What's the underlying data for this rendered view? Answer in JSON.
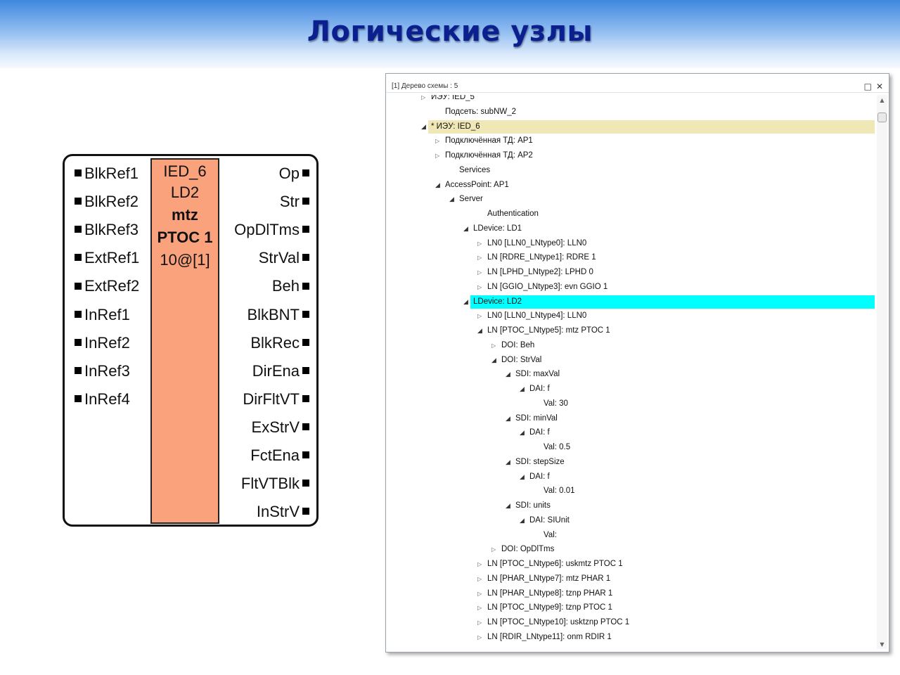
{
  "header": {
    "title": "Логические узлы"
  },
  "function_block": {
    "core": [
      "IED_6",
      "LD2",
      "mtz",
      "PTOC 1",
      "10@[1]"
    ],
    "inputs": [
      "BlkRef1",
      "BlkRef2",
      "BlkRef3",
      "ExtRef1",
      "ExtRef2",
      "InRef1",
      "InRef2",
      "InRef3",
      "InRef4"
    ],
    "outputs": [
      "Op",
      "Str",
      "OpDlTms",
      "StrVal",
      "Beh",
      "BlkBNT",
      "BlkRec",
      "DirEna",
      "DirFltVT",
      "ExStrV",
      "FctEna",
      "FltVTBlk",
      "InStrV"
    ]
  },
  "tree_window": {
    "title": "[1] Дерево схемы : 5",
    "maximize_icon": "□",
    "close_icon": "✕",
    "nodes": [
      {
        "label": "ИЭУ: IED_5",
        "level": 2,
        "toggle": "closed"
      },
      {
        "label": "Подсеть: subNW_2",
        "level": 3,
        "toggle": "none"
      },
      {
        "label": "* ИЭУ: IED_6",
        "level": 2,
        "toggle": "open",
        "highlight": "yellow"
      },
      {
        "label": "Подключённая ТД: AP1",
        "level": 3,
        "toggle": "closed"
      },
      {
        "label": "Подключённая ТД: AP2",
        "level": 3,
        "toggle": "closed"
      },
      {
        "label": "Services",
        "level": 4,
        "toggle": "none"
      },
      {
        "label": "AccessPoint: AP1",
        "level": 3,
        "toggle": "open"
      },
      {
        "label": "Server",
        "level": 4,
        "toggle": "open"
      },
      {
        "label": "Authentication",
        "level": 6,
        "toggle": "none"
      },
      {
        "label": "LDevice: LD1",
        "level": 5,
        "toggle": "open"
      },
      {
        "label": "LN0 [LLN0_LNtype0]: LLN0",
        "level": 6,
        "toggle": "closed"
      },
      {
        "label": "LN [RDRE_LNtype1]: RDRE 1",
        "level": 6,
        "toggle": "closed"
      },
      {
        "label": "LN [LPHD_LNtype2]: LPHD 0",
        "level": 6,
        "toggle": "closed"
      },
      {
        "label": "LN [GGIO_LNtype3]: evn GGIO 1",
        "level": 6,
        "toggle": "closed"
      },
      {
        "label": "LDevice: LD2",
        "level": 5,
        "toggle": "open",
        "highlight": "cyan"
      },
      {
        "label": "LN0 [LLN0_LNtype4]: LLN0",
        "level": 6,
        "toggle": "closed"
      },
      {
        "label": "LN [PTOC_LNtype5]: mtz PTOC 1",
        "level": 6,
        "toggle": "open"
      },
      {
        "label": "DOI: Beh",
        "level": 7,
        "toggle": "closed"
      },
      {
        "label": "DOI: StrVal",
        "level": 7,
        "toggle": "open"
      },
      {
        "label": "SDI: maxVal",
        "level": 8,
        "toggle": "open"
      },
      {
        "label": "DAI: f",
        "level": 9,
        "toggle": "open"
      },
      {
        "label": "Val: 30",
        "level": 10,
        "toggle": "none"
      },
      {
        "label": "SDI: minVal",
        "level": 8,
        "toggle": "open"
      },
      {
        "label": "DAI: f",
        "level": 9,
        "toggle": "open"
      },
      {
        "label": "Val: 0.5",
        "level": 10,
        "toggle": "none"
      },
      {
        "label": "SDI: stepSize",
        "level": 8,
        "toggle": "open"
      },
      {
        "label": "DAI: f",
        "level": 9,
        "toggle": "open"
      },
      {
        "label": "Val: 0.01",
        "level": 10,
        "toggle": "none"
      },
      {
        "label": "SDI: units",
        "level": 8,
        "toggle": "open"
      },
      {
        "label": "DAI: SIUnit",
        "level": 9,
        "toggle": "open"
      },
      {
        "label": "Val:",
        "level": 10,
        "toggle": "none"
      },
      {
        "label": "DOI: OpDlTms",
        "level": 7,
        "toggle": "closed"
      },
      {
        "label": "LN [PTOC_LNtype6]: uskmtz PTOC 1",
        "level": 6,
        "toggle": "closed"
      },
      {
        "label": "LN [PHAR_LNtype7]: mtz PHAR 1",
        "level": 6,
        "toggle": "closed"
      },
      {
        "label": "LN [PHAR_LNtype8]: tznp PHAR 1",
        "level": 6,
        "toggle": "closed"
      },
      {
        "label": "LN [PTOC_LNtype9]: tznp PTOC 1",
        "level": 6,
        "toggle": "closed"
      },
      {
        "label": "LN [PTOC_LNtype10]: usktznp PTOC 1",
        "level": 6,
        "toggle": "closed"
      },
      {
        "label": "LN [RDIR_LNtype11]: onm RDIR 1",
        "level": 6,
        "toggle": "closed"
      }
    ]
  },
  "colors": {
    "header_text": "#0b1f8f",
    "core_fill": "#f9a27c",
    "highlight_yellow": "#efe8b6",
    "highlight_cyan": "#00ffff"
  }
}
